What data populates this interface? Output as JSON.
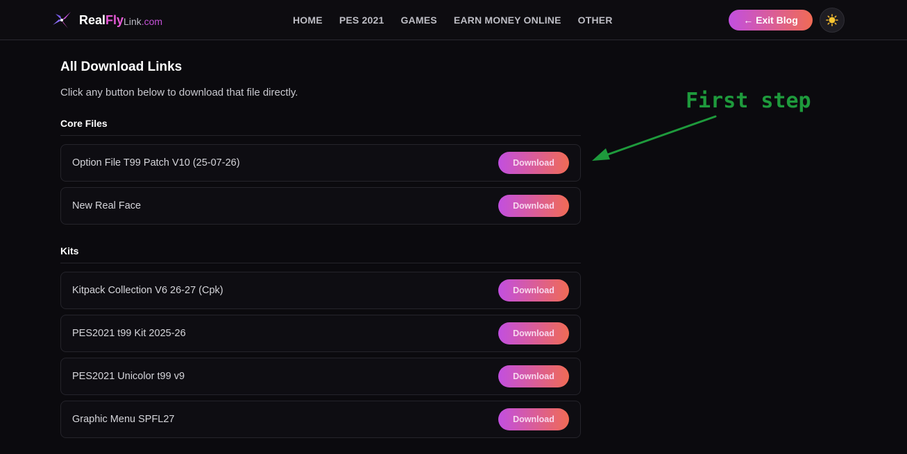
{
  "header": {
    "logo": {
      "real": "Real",
      "fly": "Fly",
      "link": "Link",
      "com": ".com",
      "icon": "pinwheel-logo-icon"
    },
    "nav": [
      "HOME",
      "PES 2021",
      "GAMES",
      "EARN MONEY ONLINE",
      "OTHER"
    ],
    "exit_label": "← Exit Blog",
    "theme_icon": "sun-icon"
  },
  "main": {
    "title": "All Download Links",
    "description": "Click any button below to download that file directly.",
    "sections": [
      {
        "title": "Core Files",
        "items": [
          {
            "name": "Option File T99 Patch V10 (25-07-26)",
            "button": "Download"
          },
          {
            "name": "New Real Face",
            "button": "Download"
          }
        ]
      },
      {
        "title": "Kits",
        "items": [
          {
            "name": "Kitpack Collection V6 26-27 (Cpk)",
            "button": "Download"
          },
          {
            "name": "PES2021 t99 Kit 2025-26",
            "button": "Download"
          },
          {
            "name": "PES2021 Unicolor t99 v9",
            "button": "Download"
          },
          {
            "name": "Graphic Menu SPFL27",
            "button": "Download"
          }
        ]
      }
    ]
  },
  "annotation": {
    "text": "First step",
    "color": "#1e9a3c"
  },
  "colors": {
    "accent_start": "#c24fe0",
    "accent_end": "#f06b55",
    "background": "#0b0a0e"
  }
}
